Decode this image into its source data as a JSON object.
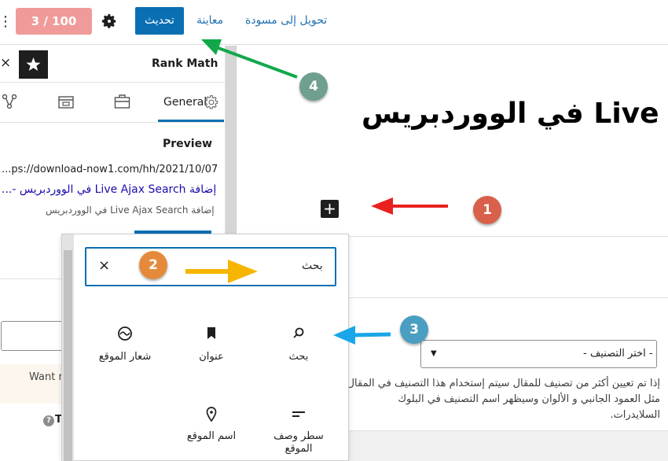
{
  "header": {
    "kebab": "⋮",
    "score": "3 / 100",
    "update_label": "تحديث",
    "preview_label": "معاينة",
    "draft_label": "تحويل إلى مسودة"
  },
  "sidebar": {
    "close": "×",
    "panel_title": "Rank Math",
    "tab_general": "General",
    "preview_heading": "Preview",
    "preview_url": "...ps://download-now1.com/hh/2021/10/07",
    "preview_title": "إضافة Live Ajax Search في الووردبريس -...",
    "preview_desc": "إضافة Live Ajax Search في الووردبريس",
    "want_text": "Want r",
    "help_text": "T"
  },
  "editor": {
    "post_title": "Live في الووردبريس",
    "add_block": "+",
    "category_select": "- اختر التصنيف -",
    "category_help": "إذا تم تعيين أكثر من تصنيف للمقال سيتم إستخدام هذا التصنيف في المقال مثل العمود الجانبي و الألوان وسيظهر اسم التصنيف في البلوك السلايدرات."
  },
  "inserter": {
    "search_value": "بحث",
    "clear": "×",
    "blocks": [
      {
        "label": "بحث",
        "icon": "search-icon"
      },
      {
        "label": "عنوان",
        "icon": "bookmark-icon"
      },
      {
        "label": "شعار الموقع",
        "icon": "site-logo-icon"
      },
      {
        "label": "سطر وصف الموقع",
        "icon": "tagline-icon"
      },
      {
        "label": "اسم الموقع",
        "icon": "map-marker-icon"
      }
    ]
  },
  "annotations": {
    "n1": "1",
    "n2": "2",
    "n3": "3",
    "n4": "4",
    "color_red": "#e8211f",
    "color_orange": "#f7b500",
    "color_blue": "#1aa6e8",
    "color_green": "#12a84a"
  }
}
